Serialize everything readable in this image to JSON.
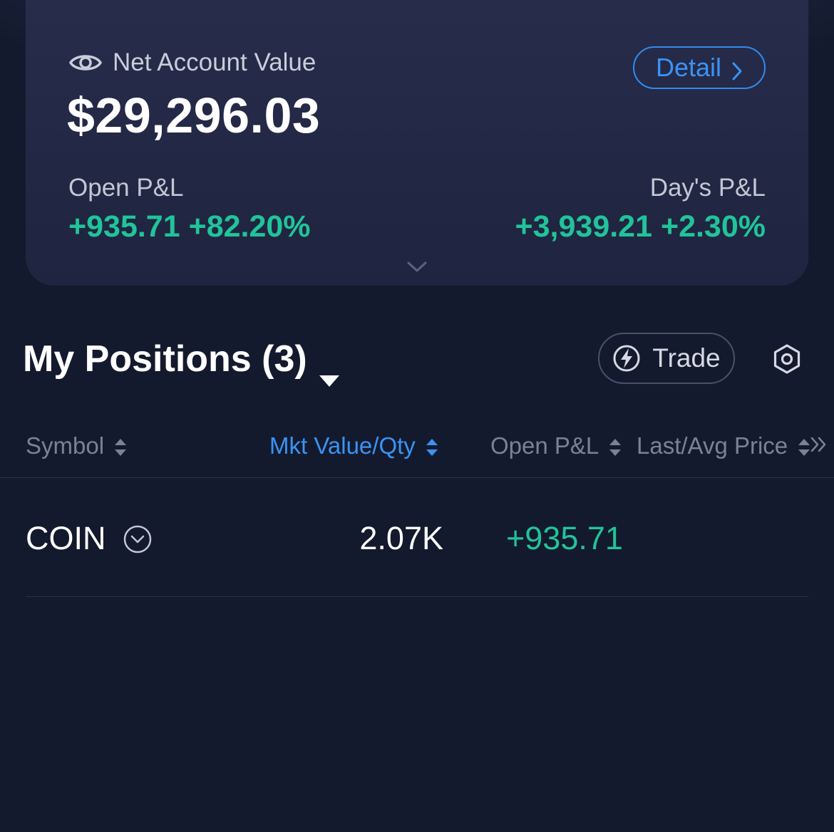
{
  "account": {
    "label": "Net Account Value",
    "value": "$29,296.03",
    "detail_label": "Detail",
    "open_pl_label": "Open P&L",
    "open_pl_value": "+935.71 +82.20%",
    "days_pl_label": "Day's P&L",
    "days_pl_value": "+3,939.21 +2.30%"
  },
  "positions": {
    "title": "My Positions (3)",
    "trade_label": "Trade",
    "columns": [
      "Symbol",
      "Mkt Value/Qty",
      "Open P&L",
      "Last/Avg Price"
    ],
    "rows": [
      {
        "symbol": "COIN",
        "mkt_value": "2.07K",
        "open_pl": "+935.71"
      }
    ]
  },
  "icons": {
    "eye": "eye-icon",
    "detail_chevron": "chevron-right-icon",
    "expand": "chevron-down-icon",
    "dropdown": "caret-down-icon",
    "trade": "bolt-icon",
    "settings": "settings-icon",
    "sort": "sort-icon",
    "more_columns": "double-chevron-right-icon",
    "row_expand": "circle-chevron-down-icon"
  },
  "colors": {
    "background": "#141a2d",
    "card": "#232946",
    "accent_blue": "#3a93f5",
    "positive_green": "#21c49a"
  }
}
